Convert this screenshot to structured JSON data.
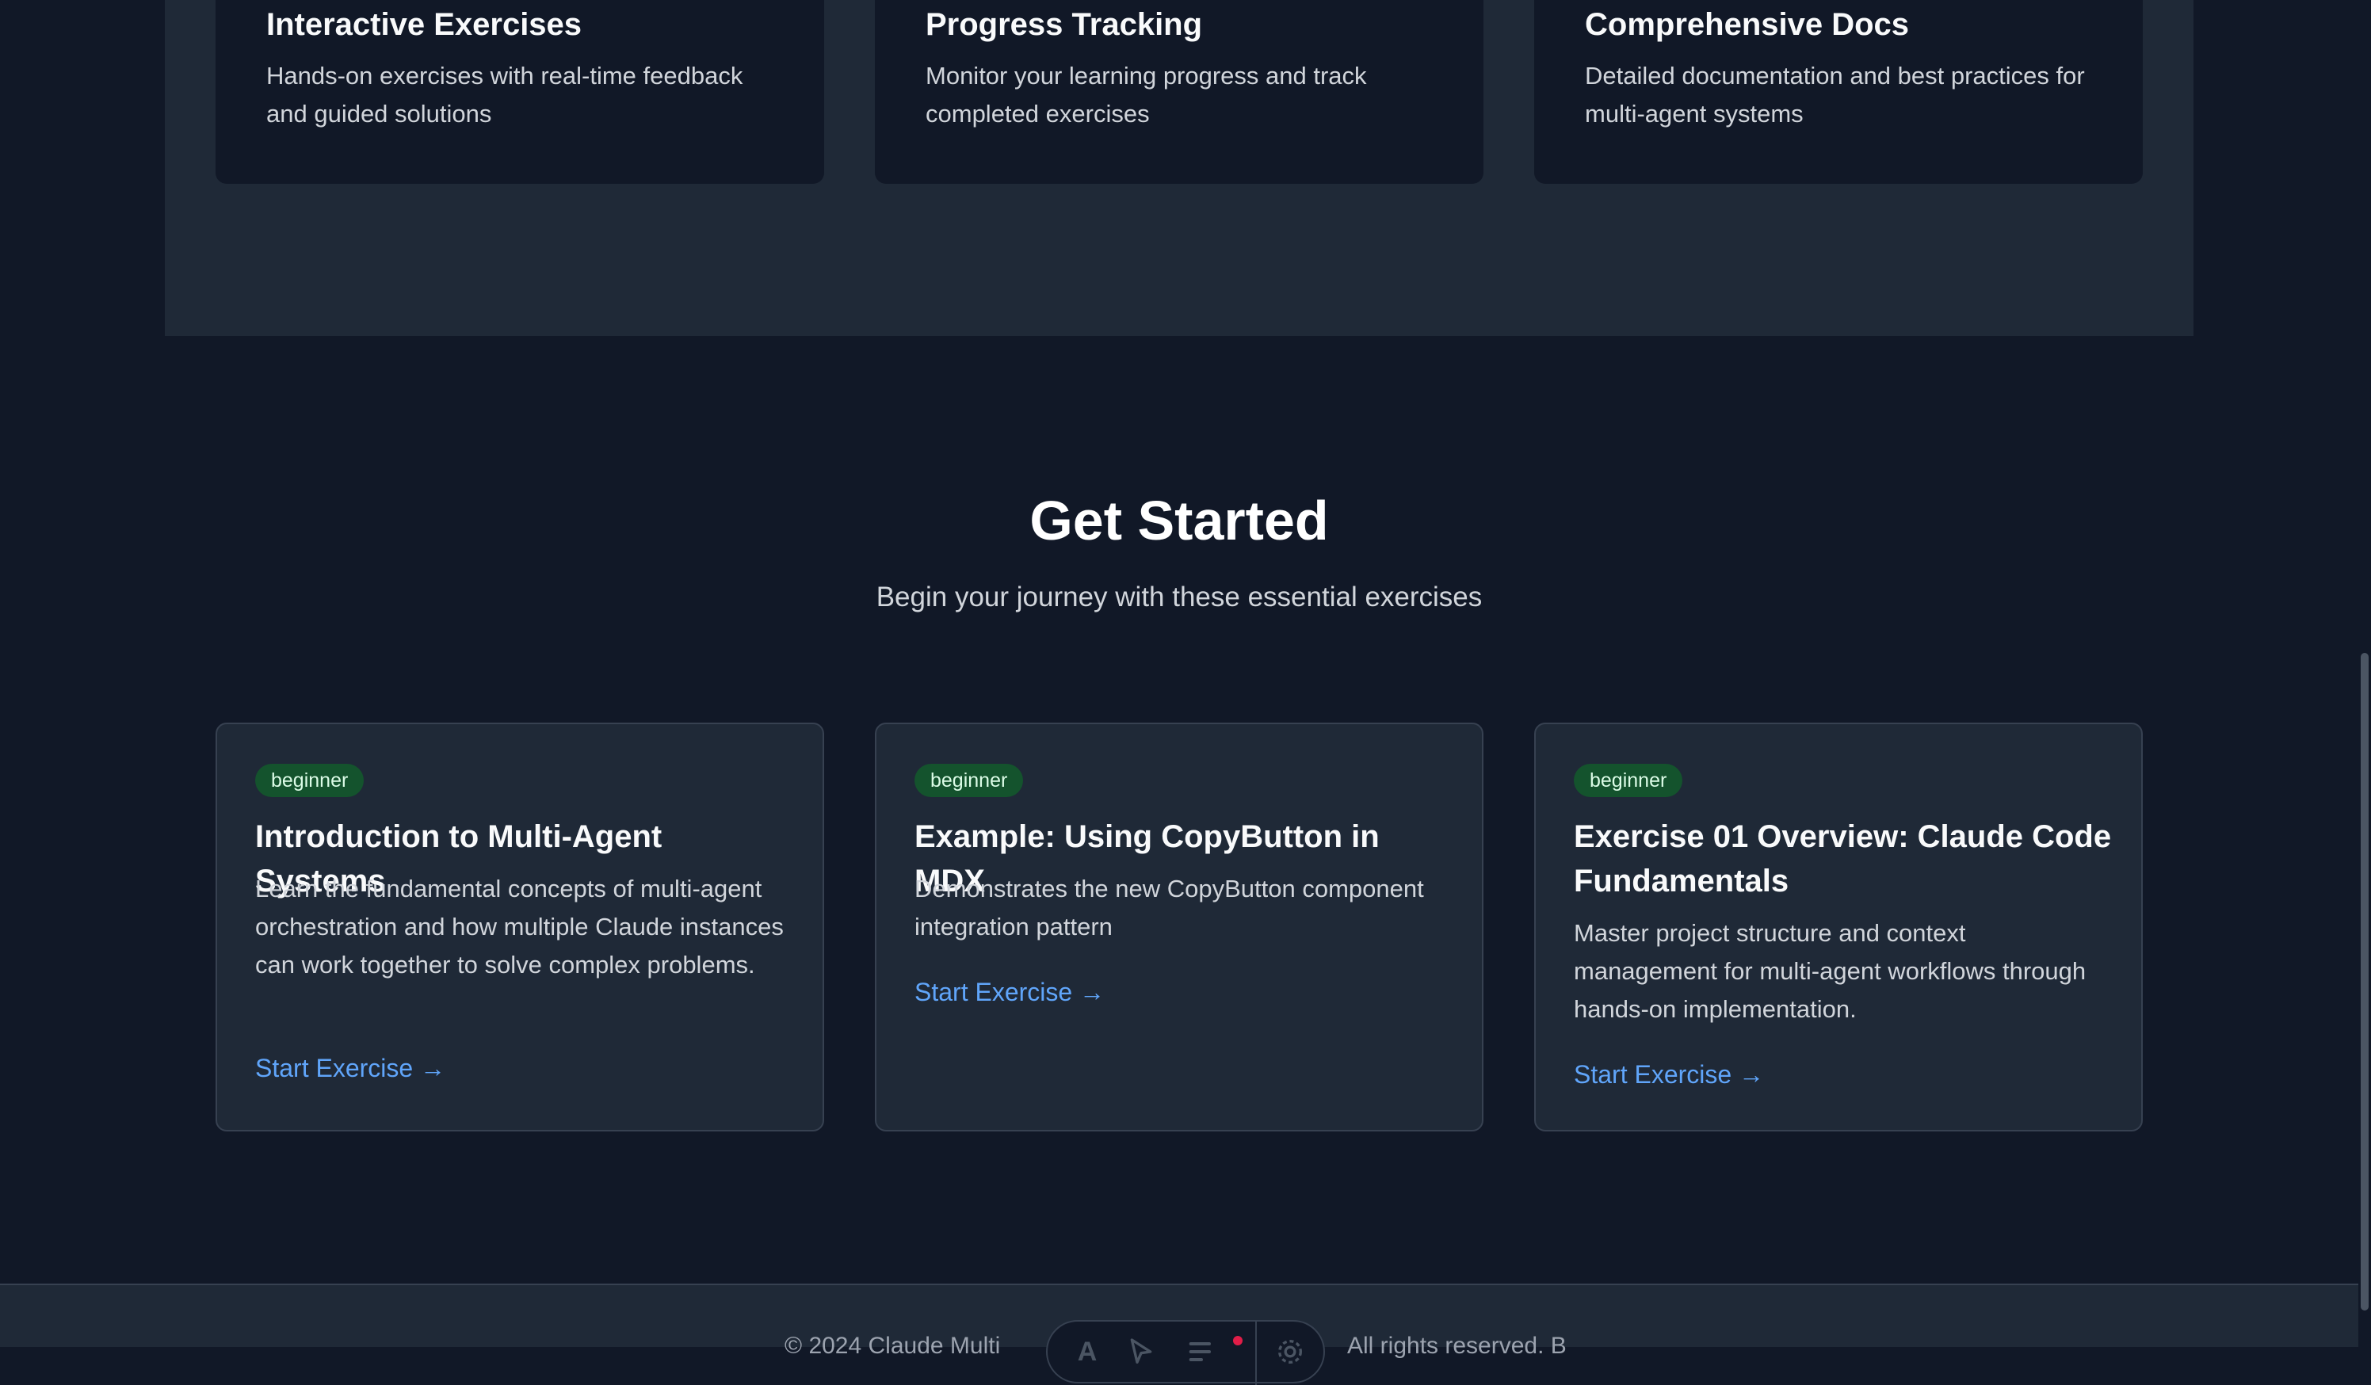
{
  "features": [
    {
      "title": "Interactive Exercises",
      "description": "Hands-on exercises with real-time feedback and guided solutions"
    },
    {
      "title": "Progress Tracking",
      "description": "Monitor your learning progress and track completed exercises"
    },
    {
      "title": "Comprehensive Docs",
      "description": "Detailed documentation and best practices for multi-agent systems"
    }
  ],
  "get_started": {
    "title": "Get Started",
    "subtitle": "Begin your journey with these essential exercises",
    "cards": [
      {
        "badge": "beginner",
        "title": "Introduction to Multi-Agent Systems",
        "description": "Learn the fundamental concepts of multi-agent orchestration and how multiple Claude instances can work together to solve complex problems.",
        "link": "Start Exercise →"
      },
      {
        "badge": "beginner",
        "title": "Example: Using CopyButton in MDX",
        "description": "Demonstrates the new CopyButton component integration pattern",
        "link": "Start Exercise →"
      },
      {
        "badge": "beginner",
        "title": "Exercise 01 Overview: Claude Code Fundamentals",
        "description": "Master project structure and context management for multi-agent workflows through hands-on implementation.",
        "link": "Start Exercise →"
      }
    ]
  },
  "footer": {
    "left_text": "© 2024 Claude Multi",
    "right_text": "All rights reserved. B"
  },
  "toolbar": {
    "icons": [
      "a-icon",
      "pointer-icon",
      "list-icon",
      "settings-icon"
    ]
  },
  "colors": {
    "background": "#111827",
    "panel": "#1f2937",
    "accent_link": "#60a5fa",
    "badge_bg": "#14532d"
  }
}
